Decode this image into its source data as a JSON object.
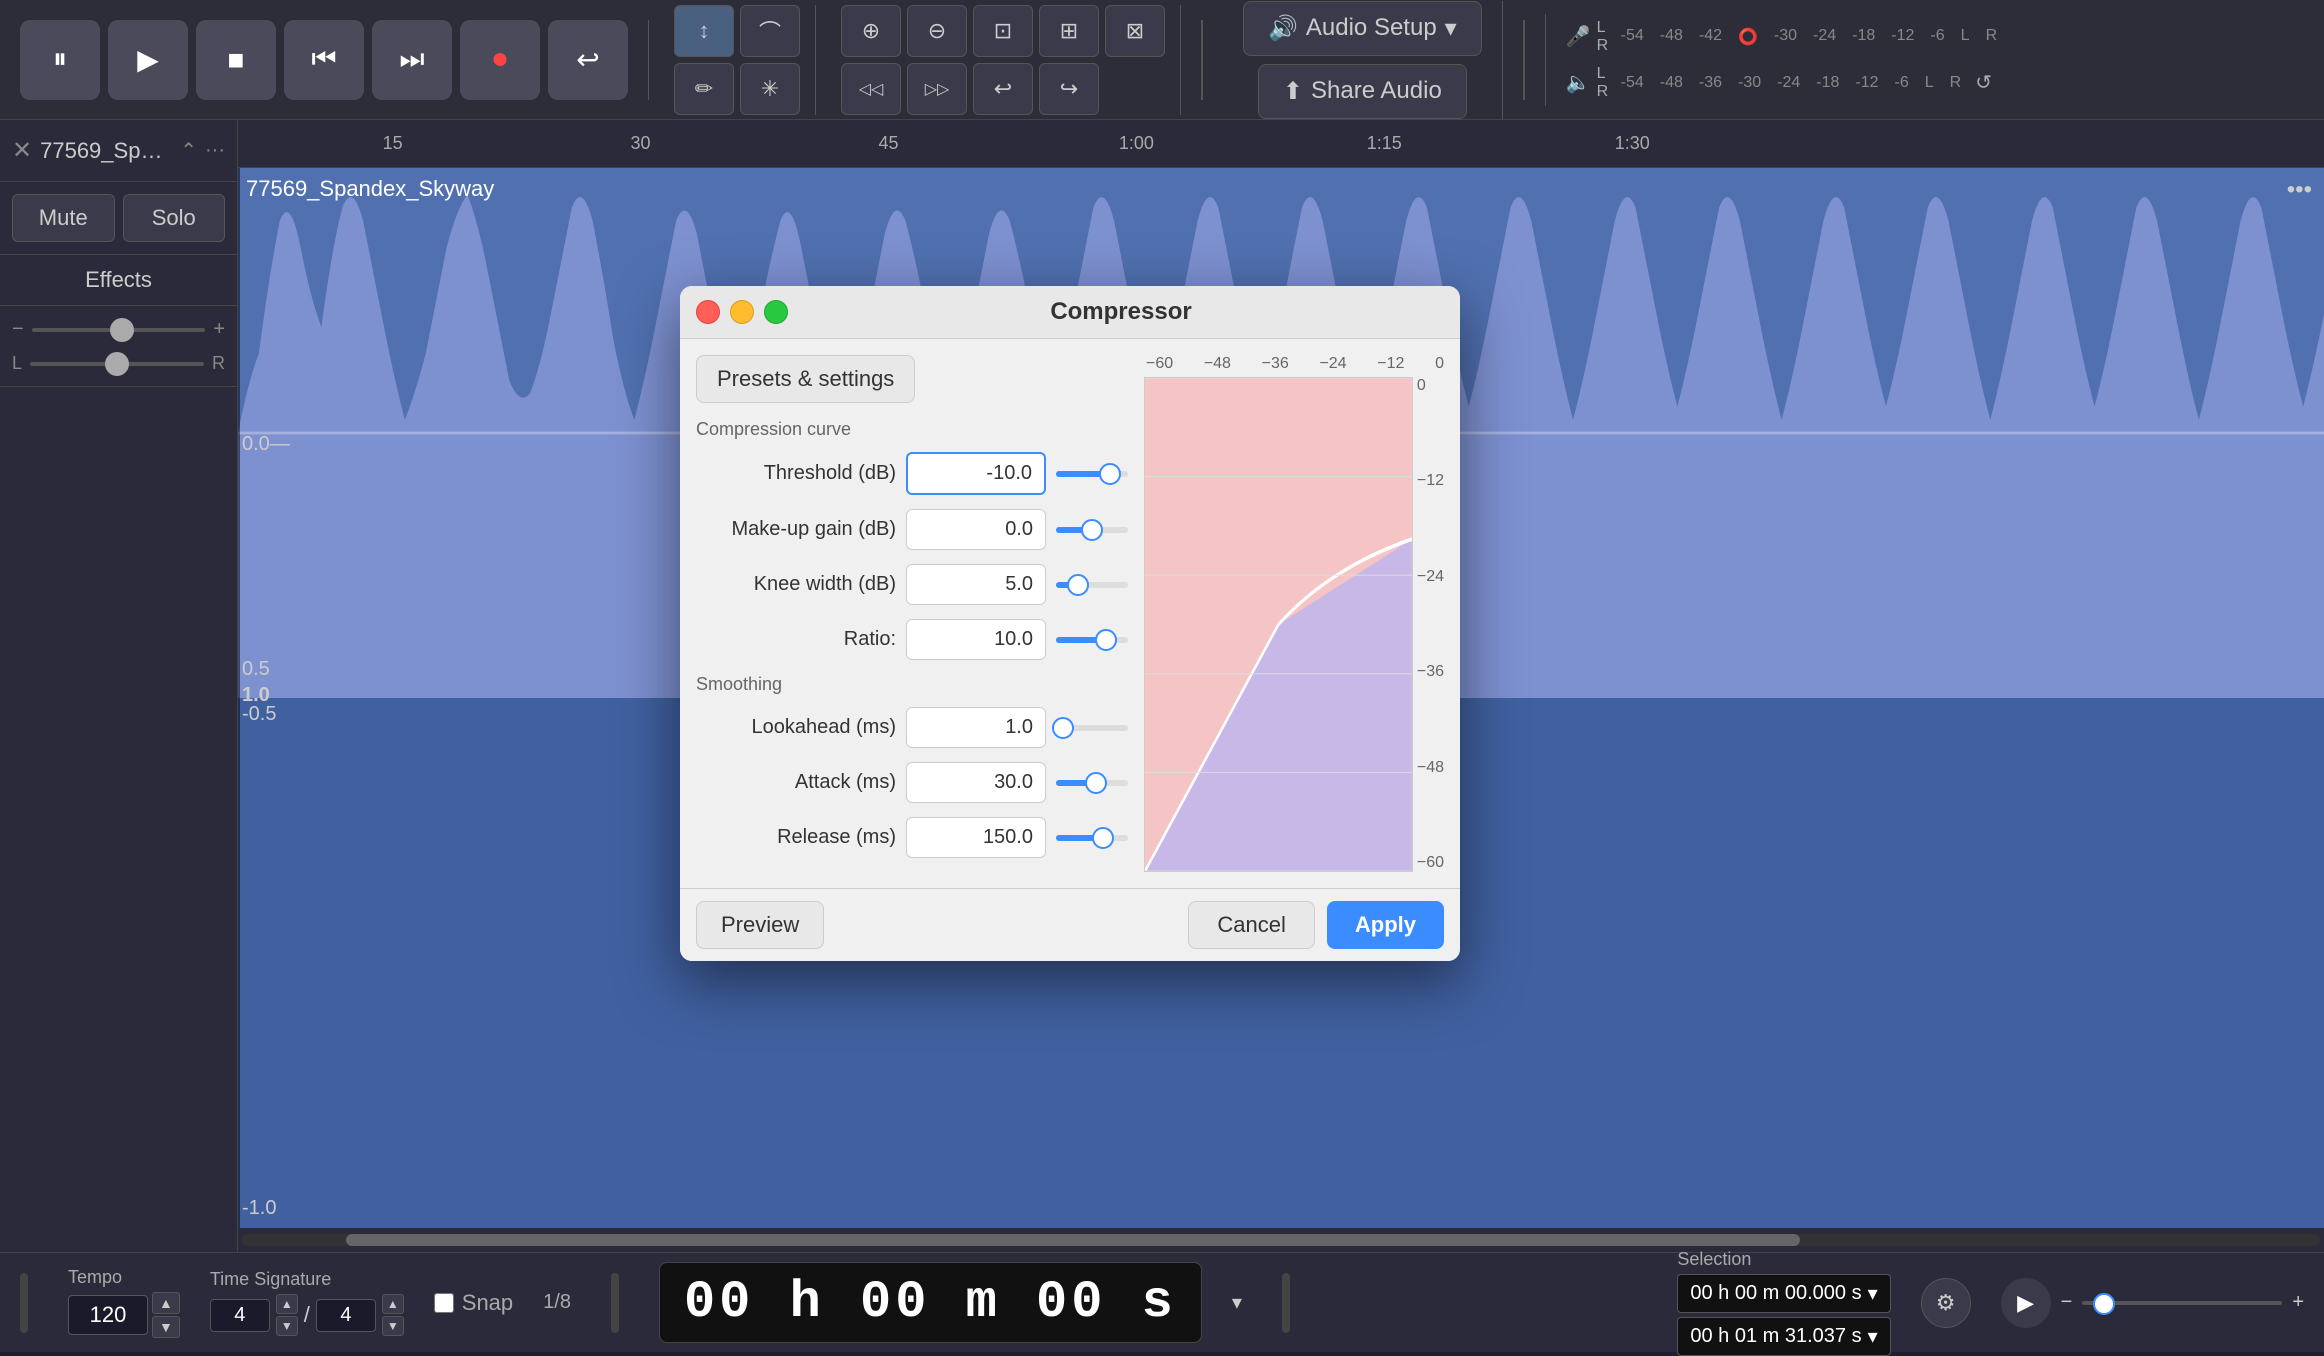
{
  "toolbar": {
    "transport": {
      "pause_label": "⏸",
      "play_label": "▶",
      "stop_label": "■",
      "rewind_label": "⏮",
      "forward_label": "⏭",
      "record_label": "⏺",
      "loop_label": "↩"
    },
    "tools": {
      "cursor_label": "↕",
      "connect_label": "⌒",
      "pencil_label": "✏",
      "star_label": "✳",
      "zoom_in_label": "⊕",
      "zoom_out_label": "⊖",
      "zoom_fit_label": "⊡",
      "zoom_sel_label": "⊞",
      "zoom_full_label": "⊠",
      "undo_label": "↩",
      "redo_label": "↪",
      "trim1_label": "◁◁",
      "trim2_label": "▷▷"
    },
    "audio_setup": {
      "icon": "🔊",
      "label": "Audio Setup",
      "arrow": "▾"
    },
    "share_audio": {
      "icon": "⬆",
      "label": "Share Audio"
    }
  },
  "vu_meter": {
    "input_icon": "🎤",
    "output_icon": "🔈",
    "labels": [
      "-54",
      "-48",
      "-42",
      "⭕",
      "-30",
      "-24",
      "-18",
      "-12",
      "-6",
      "L",
      "R"
    ],
    "labels2": [
      "-54",
      "-48",
      "-36",
      "-30",
      "-24",
      "-18",
      "-12",
      "-6",
      "L",
      "R"
    ]
  },
  "track": {
    "name": "77569_Spand...",
    "full_name": "77569_Spandex_Skyway",
    "mute_label": "Mute",
    "solo_label": "Solo",
    "effects_label": "Effects",
    "more_icon": "•••"
  },
  "ruler": {
    "ticks": [
      "15",
      "30",
      "45",
      "1:00",
      "1:15",
      "1:30"
    ]
  },
  "compressor": {
    "title": "Compressor",
    "presets_label": "Presets & settings",
    "curve_label": "Compression curve",
    "params": {
      "threshold_label": "Threshold (dB)",
      "threshold_value": "-10.0",
      "makeup_label": "Make-up gain (dB)",
      "makeup_value": "0.0",
      "knee_label": "Knee width (dB)",
      "knee_value": "5.0",
      "ratio_label": "Ratio:",
      "ratio_value": "10.0"
    },
    "smoothing_label": "Smoothing",
    "smoothing": {
      "lookahead_label": "Lookahead (ms)",
      "lookahead_value": "1.0",
      "attack_label": "Attack (ms)",
      "attack_value": "30.0",
      "release_label": "Release (ms)",
      "release_value": "150.0"
    },
    "curve_axis_top": [
      "−60",
      "−48",
      "−36",
      "−24",
      "−12",
      "0"
    ],
    "curve_axis_right": [
      "0",
      "−12",
      "−24",
      "−36",
      "−48",
      "−60"
    ],
    "preview_label": "Preview",
    "cancel_label": "Cancel",
    "apply_label": "Apply"
  },
  "bottom_bar": {
    "tempo_label": "Tempo",
    "tempo_value": "120",
    "time_sig_label": "Time Signature",
    "time_sig_num": "4",
    "time_sig_den": "4",
    "snap_label": "Snap",
    "snap_value": "1/8",
    "time_display": "00 h 00 m 00 s",
    "selection_label": "Selection",
    "selection_start": "00 h 00 m 00.000 s",
    "selection_end": "00 h 01 m 31.037 s"
  }
}
